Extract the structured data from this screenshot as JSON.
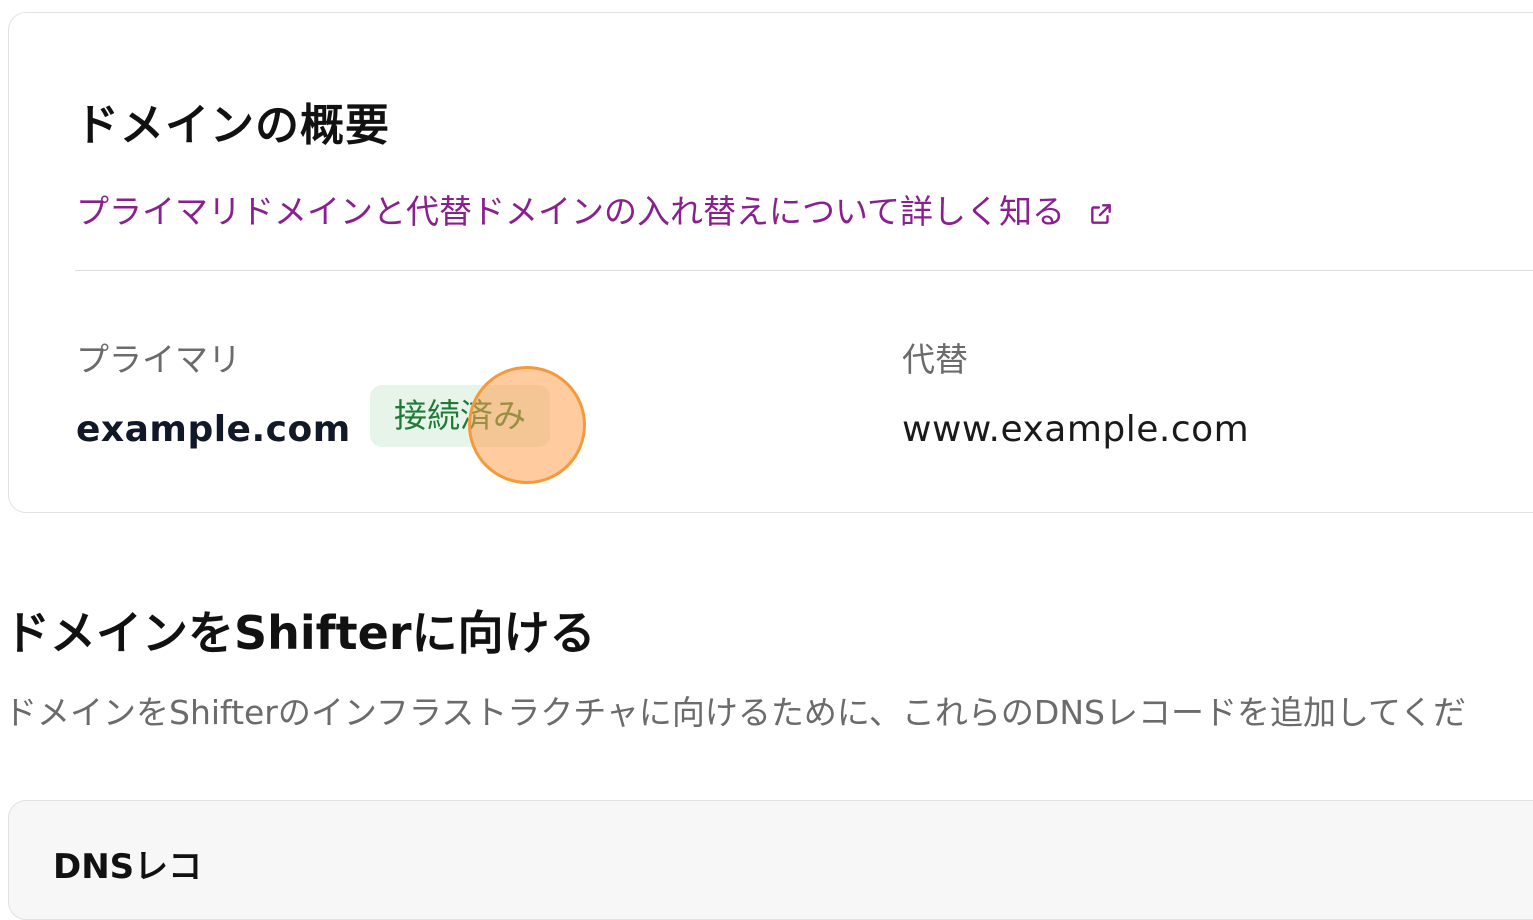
{
  "overview": {
    "title": "ドメインの概要",
    "learn_link": "プライマリドメインと代替ドメインの入れ替えについて詳しく知る",
    "external_icon": "external-link-icon",
    "primary": {
      "label": "プライマリ",
      "value": "example.com",
      "status": "接続済み"
    },
    "alternate": {
      "label": "代替",
      "value": "www.example.com"
    }
  },
  "pointing": {
    "title": "ドメインをShifterに向ける",
    "description": "ドメインをShifterのインフラストラクチャに向けるために、これらのDNSレコードを追加してくだ"
  },
  "dns_card": {
    "title": "DNSレコ"
  },
  "colors": {
    "link": "#8a1f8f",
    "status_text": "#1f7a37",
    "status_bg": "#e6f4e9",
    "click_marker": "#f59a3c"
  }
}
